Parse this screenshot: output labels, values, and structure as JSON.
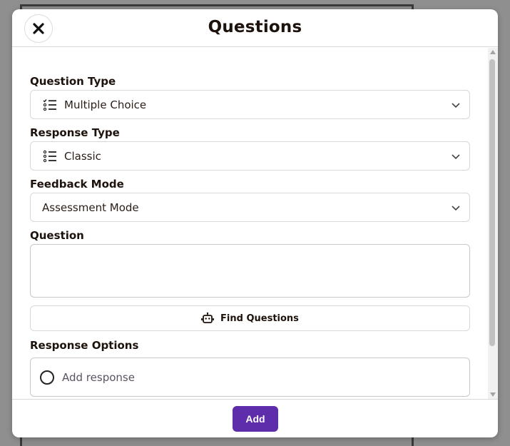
{
  "modal": {
    "title": "Questions",
    "close_icon": "close-icon"
  },
  "question_type": {
    "label": "Question Type",
    "value": "Multiple Choice",
    "icon": "checklist-icon"
  },
  "response_type": {
    "label": "Response Type",
    "value": "Classic",
    "icon": "list-icon"
  },
  "feedback_mode": {
    "label": "Feedback Mode",
    "value": "Assessment Mode"
  },
  "question": {
    "label": "Question",
    "value": ""
  },
  "find_questions": {
    "label": "Find Questions",
    "icon": "robot-icon"
  },
  "response_options": {
    "label": "Response Options",
    "add_placeholder": "Add response"
  },
  "footer": {
    "add_label": "Add"
  },
  "colors": {
    "accent": "#5e2dab",
    "text": "#1e120c"
  }
}
